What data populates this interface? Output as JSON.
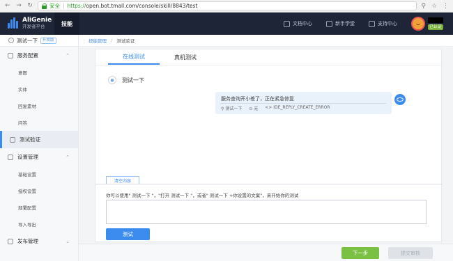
{
  "browser": {
    "secure_label": "安全",
    "url_scheme": "https://",
    "url_rest": "open.bot.tmall.com/console/skill/8843/test"
  },
  "header": {
    "logo_title": "AliGenie",
    "logo_subtitle": "开发者平台",
    "tab_label": "技能",
    "links": [
      "文档中心",
      "新手学堂",
      "支持中心"
    ],
    "user_badge": "已认证"
  },
  "sidebar": {
    "skill_name": "测试一下",
    "skill_tag": "开发版",
    "groups": {
      "service_config": "服务配置",
      "service_items": [
        "意图",
        "实体",
        "回复素材",
        "问答"
      ],
      "test_validate": "测试验证",
      "settings": "设置管理",
      "settings_items": [
        "基础设置",
        "授权设置",
        "部署配置",
        "导入导出"
      ],
      "publish": "发布管理"
    }
  },
  "breadcrumb": {
    "root": "技能管理",
    "current": "测试验证"
  },
  "main": {
    "tabs": [
      "在线测试",
      "真机测试"
    ],
    "user_message": "测试一下",
    "reply": {
      "text": "服务查询开小差了，正在紧急修复",
      "meta_skill": "测试一下",
      "meta_none": "无",
      "meta_code": "IDE_REPLY_CREATE_ERROR"
    },
    "clear_label": "清空内容",
    "hint": "你可以使用\" 测试一下 \"，\"打开 测试一下 \"，或者\" 测试一下 +你设置的文案\"，来开始你的测试",
    "input_value": "",
    "test_button": "测试"
  },
  "footer": {
    "next_button": "下一步",
    "submit_button": "提交审核"
  },
  "colors": {
    "accent": "#3c8cf0",
    "header_bg": "#1e2537",
    "next_green": "#7ac143"
  }
}
